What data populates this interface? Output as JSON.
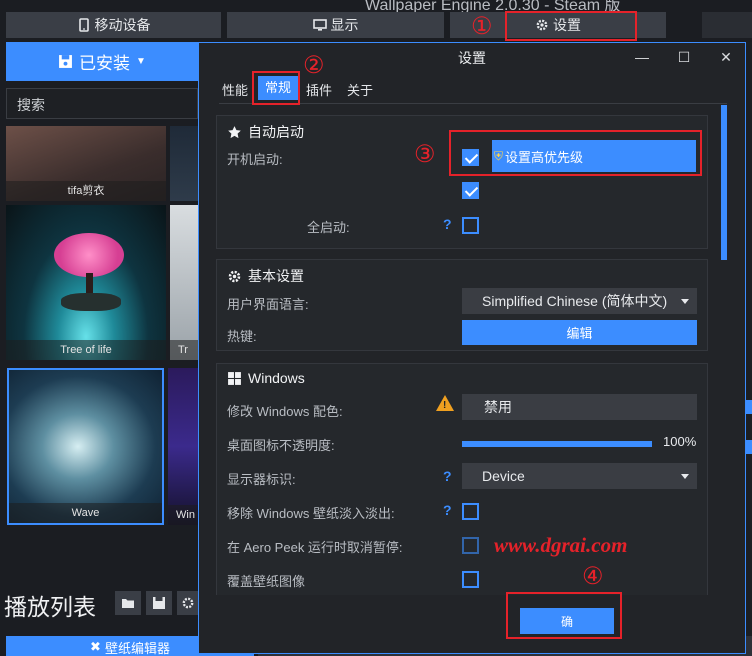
{
  "app": {
    "title": "Wallpaper Engine 2.0.30 - Steam 版"
  },
  "topbar": {
    "mobile_label": "移动设备",
    "display_label": "显示",
    "settings_label": "设置"
  },
  "left": {
    "installed_label": "已安装",
    "search_placeholder": "搜索",
    "thumbs": [
      {
        "label": "tifa剪衣"
      },
      {
        "label": "Tree of life"
      },
      {
        "label": "Tr"
      },
      {
        "label": "Wave"
      },
      {
        "label": "Win"
      }
    ],
    "playlist_title": "播放列表",
    "editor_label": "壁纸编辑器"
  },
  "dialog": {
    "title": "设置",
    "tabs": [
      "性能",
      "常规",
      "插件",
      "关于"
    ],
    "active_tab": "常规",
    "autostart": {
      "heading": "自动启动",
      "boot_label": "开机启动:",
      "priority_btn": "设置高优先级",
      "safe_label": "全启动:"
    },
    "basic": {
      "heading": "基本设置",
      "lang_label": "用户界面语言:",
      "lang_value": "Simplified Chinese (简体中文)",
      "hotkey_label": "热键:",
      "hotkey_btn": "编辑"
    },
    "windows": {
      "heading": "Windows",
      "color_label": "修改 Windows 配色:",
      "color_value": "禁用",
      "opacity_label": "桌面图标不透明度:",
      "opacity_value": "100%",
      "opacity_level": 1.0,
      "monitor_label": "显示器标识:",
      "monitor_value": "Device",
      "fade_label": "移除 Windows 壁纸淡入淡出:",
      "aero_label": "在 Aero Peek 运行时取消暂停:",
      "cover_label": "覆盖壁纸图像"
    },
    "ok_label": "确"
  },
  "annotations": {
    "n1": "①",
    "n2": "②",
    "n3": "③",
    "n4": "④",
    "watermark": "www.dgrai.com"
  },
  "colors": {
    "accent": "#3c8dff",
    "annotation": "#e5222a",
    "background": "#1b1d22"
  }
}
